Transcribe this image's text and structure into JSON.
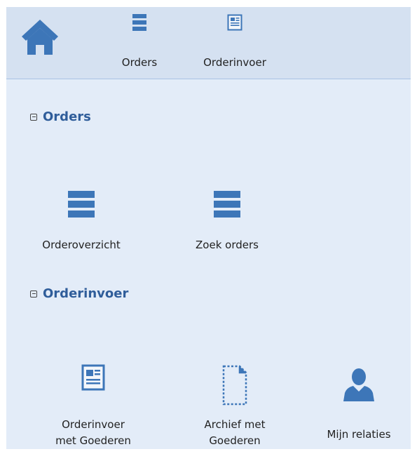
{
  "topbar": {
    "home_icon": "home-icon",
    "buttons": [
      {
        "label": "Orders",
        "icon": "list-icon"
      },
      {
        "label": "Orderinvoer",
        "icon": "form-icon"
      }
    ]
  },
  "sections": [
    {
      "title": "Orders",
      "items": [
        {
          "label": "Orderoverzicht",
          "icon": "list-icon"
        },
        {
          "label": "Zoek orders",
          "icon": "list-icon"
        }
      ]
    },
    {
      "title": "Orderinvoer",
      "items": [
        {
          "label_line1": "Orderinvoer",
          "label_line2": "met Goederen",
          "icon": "form-icon"
        },
        {
          "label_line1": "Archief met",
          "label_line2": "Goederen",
          "icon": "dashed-document-icon"
        },
        {
          "label": "Mijn relaties",
          "icon": "person-icon"
        }
      ]
    }
  ],
  "colors": {
    "accent": "#2f5d9a",
    "icon": "#3d76b8",
    "panel": "#e3ecf8",
    "header": "#d5e1f1"
  }
}
